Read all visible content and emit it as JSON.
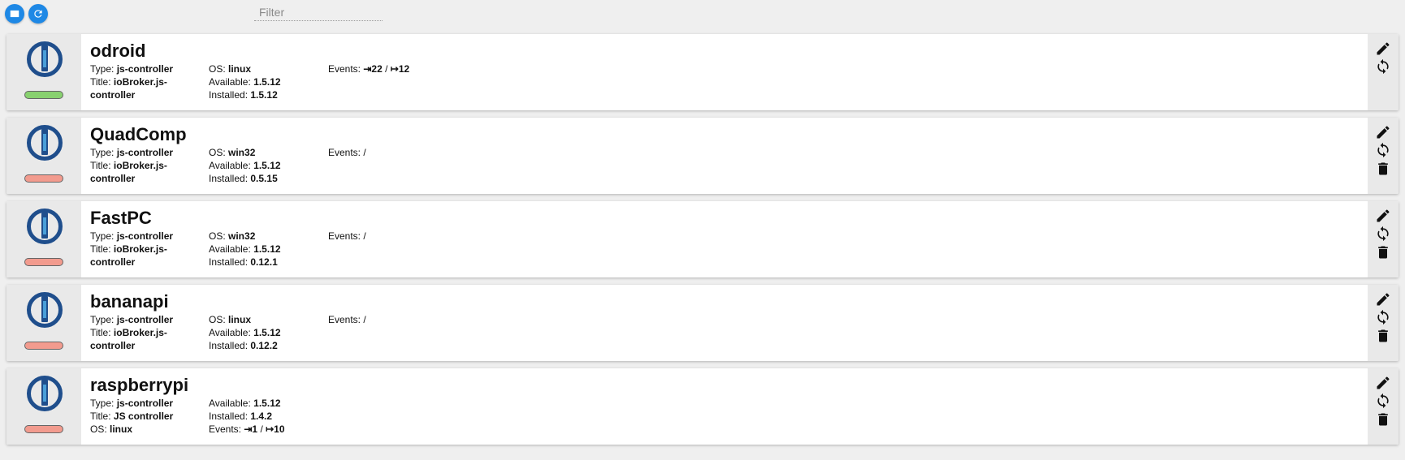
{
  "toolbar": {
    "filter_placeholder": "Filter",
    "buttons": [
      {
        "icon": "tile-view-icon"
      },
      {
        "icon": "refresh-icon"
      }
    ]
  },
  "colors": {
    "accent": "#1e88e5",
    "status_ok": "#88d16f",
    "status_bad": "#f29b8e",
    "logo_blue": "#1f4e8c",
    "logo_light": "#4a9fd8"
  },
  "hosts": [
    {
      "name": "odroid",
      "status": "ok",
      "type_label": "Type:",
      "type": "js-controller",
      "title_label": "Title:",
      "title": "ioBroker.js-controller",
      "os_label": "OS:",
      "os": "linux",
      "available_label": "Available:",
      "available": "1.5.12",
      "installed_label": "Installed:",
      "installed": "1.5.12",
      "events_label": "Events:",
      "events_in": "⇥22",
      "events_sep": " / ",
      "events_out": "↦12",
      "actions": [
        "edit",
        "reload"
      ]
    },
    {
      "name": "QuadComp",
      "status": "bad",
      "type_label": "Type:",
      "type": "js-controller",
      "title_label": "Title:",
      "title": "ioBroker.js-controller",
      "os_label": "OS:",
      "os": "win32",
      "available_label": "Available:",
      "available": "1.5.12",
      "installed_label": "Installed:",
      "installed": "0.5.15",
      "events_label": "Events:",
      "events_in": "",
      "events_sep": " /",
      "events_out": "",
      "actions": [
        "edit",
        "reload",
        "delete"
      ]
    },
    {
      "name": "FastPC",
      "status": "bad",
      "type_label": "Type:",
      "type": "js-controller",
      "title_label": "Title:",
      "title": "ioBroker.js-controller",
      "os_label": "OS:",
      "os": "win32",
      "available_label": "Available:",
      "available": "1.5.12",
      "installed_label": "Installed:",
      "installed": "0.12.1",
      "events_label": "Events:",
      "events_in": "",
      "events_sep": " /",
      "events_out": "",
      "actions": [
        "edit",
        "reload",
        "delete"
      ]
    },
    {
      "name": "bananapi",
      "status": "bad",
      "type_label": "Type:",
      "type": "js-controller",
      "title_label": "Title:",
      "title": "ioBroker.js-controller",
      "os_label": "OS:",
      "os": "linux",
      "available_label": "Available:",
      "available": "1.5.12",
      "installed_label": "Installed:",
      "installed": "0.12.2",
      "events_label": "Events:",
      "events_in": "",
      "events_sep": " /",
      "events_out": "",
      "actions": [
        "edit",
        "reload",
        "delete"
      ]
    },
    {
      "name": "raspberrypi",
      "status": "bad",
      "type_label": "Type:",
      "type": "js-controller",
      "title_label": "Title:",
      "title": "JS controller",
      "os_label": "OS:",
      "os": "linux",
      "available_label": "Available:",
      "available": "1.5.12",
      "installed_label": "Installed:",
      "installed": "1.4.2",
      "events_label": "Events:",
      "events_in": "⇥1",
      "events_sep": " / ",
      "events_out": "↦10",
      "actions": [
        "edit",
        "reload",
        "delete"
      ]
    }
  ]
}
